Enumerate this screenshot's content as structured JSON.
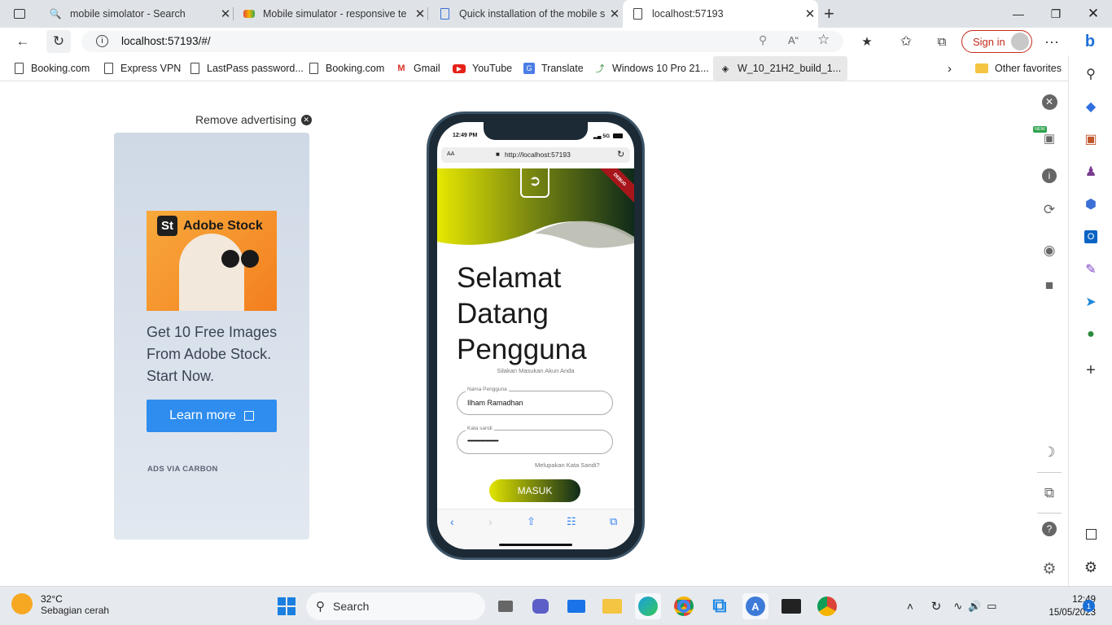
{
  "tabs": [
    {
      "title": "mobile simolator - Search",
      "icon": "search-icon"
    },
    {
      "title": "Mobile simulator - responsive te",
      "icon": "extension-icon"
    },
    {
      "title": "Quick installation of the mobile s",
      "icon": "page-icon"
    },
    {
      "title": "localhost:57193",
      "icon": "page-icon",
      "active": true
    }
  ],
  "address": {
    "url": "localhost:57193/#/"
  },
  "signin": {
    "label": "Sign in"
  },
  "favorites": [
    {
      "label": "Booking.com"
    },
    {
      "label": "Express VPN"
    },
    {
      "label": "LastPass password..."
    },
    {
      "label": "Booking.com"
    },
    {
      "label": "Gmail"
    },
    {
      "label": "YouTube"
    },
    {
      "label": "Translate"
    },
    {
      "label": "Windows 10 Pro 21..."
    },
    {
      "label": "W_10_21H2_build_1..."
    }
  ],
  "other_favorites": "Other favorites",
  "ad": {
    "remove": "Remove advertising",
    "brand": "Adobe Stock",
    "brand_badge": "St",
    "text": [
      "Get 10 Free Images",
      "From Adobe Stock.",
      "Start Now."
    ],
    "button": "Learn more",
    "via": "ADS VIA CARBON"
  },
  "phone": {
    "time": "12:49 PM",
    "signal": "5G",
    "text_size": "AA",
    "url": "http://localhost:57193",
    "debug": "DEBUG",
    "welcome": [
      "Selamat",
      "Datang",
      "Pengguna"
    ],
    "subtitle": "Silakan Masukan Akun Anda",
    "username_label": "Nama Pengguna",
    "username_value": "Ilham Ramadhan",
    "password_label": "Kata sandi",
    "password_value": "••••••••••••••••••••••••••",
    "forgot": "Melupakan Kata Sandi?",
    "login": "MASUK"
  },
  "taskbar": {
    "temp": "32°C",
    "weather": "Sebagian cerah",
    "search": "Search",
    "time": "12:49",
    "date": "15/05/2023",
    "notification_count": "1"
  },
  "colors": {
    "brand_red": "#c42b1c",
    "learn_blue": "#2e8def",
    "gradient_start": "#e2e400",
    "gradient_end": "#0f2a1a"
  }
}
